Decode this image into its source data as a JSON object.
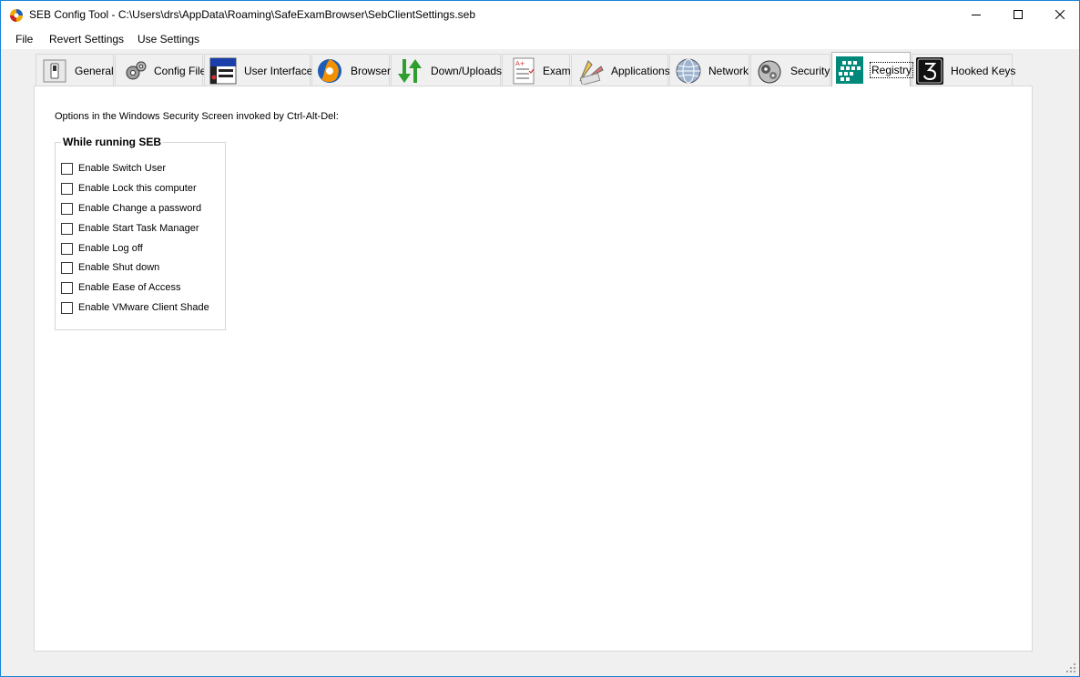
{
  "window": {
    "title": "SEB Config Tool - C:\\Users\\drs\\AppData\\Roaming\\SafeExamBrowser\\SebClientSettings.seb",
    "app_icon": "seb-app-icon",
    "controls": {
      "minimize": "minimize-icon",
      "maximize": "maximize-icon",
      "close": "close-icon"
    }
  },
  "menu": {
    "items": [
      {
        "label": "File"
      },
      {
        "label": "Revert Settings"
      },
      {
        "label": "Use Settings"
      }
    ]
  },
  "tabs": [
    {
      "label": "General",
      "icon": "switch-icon"
    },
    {
      "label": "Config File",
      "icon": "gears-icon"
    },
    {
      "label": "User Interface",
      "icon": "window-menu-icon"
    },
    {
      "label": "Browser",
      "icon": "browser-globe-icon"
    },
    {
      "label": "Down/Uploads",
      "icon": "down-up-arrows-icon"
    },
    {
      "label": "Exam",
      "icon": "exam-sheet-icon"
    },
    {
      "label": "Applications",
      "icon": "applications-icon"
    },
    {
      "label": "Network",
      "icon": "network-globe-icon"
    },
    {
      "label": "Security",
      "icon": "security-gears-icon"
    },
    {
      "label": "Registry",
      "icon": "registry-grid-icon",
      "selected": true
    },
    {
      "label": "Hooked Keys",
      "icon": "hooked-key-icon"
    }
  ],
  "registry": {
    "intro": "Options in the Windows Security Screen invoked by Ctrl-Alt-Del:",
    "group_title": "While running SEB",
    "options": [
      {
        "label": "Enable Switch User",
        "checked": false
      },
      {
        "label": "Enable Lock this computer",
        "checked": false
      },
      {
        "label": "Enable Change a password",
        "checked": false
      },
      {
        "label": "Enable Start Task Manager",
        "checked": false
      },
      {
        "label": "Enable Log off",
        "checked": false
      },
      {
        "label": "Enable Shut down",
        "checked": false
      },
      {
        "label": "Enable Ease of Access",
        "checked": false
      },
      {
        "label": "Enable VMware Client Shade",
        "checked": false
      }
    ]
  },
  "colors": {
    "window_border": "#1883d7",
    "background": "#f0f0f0",
    "registry_icon": "#00897b"
  }
}
